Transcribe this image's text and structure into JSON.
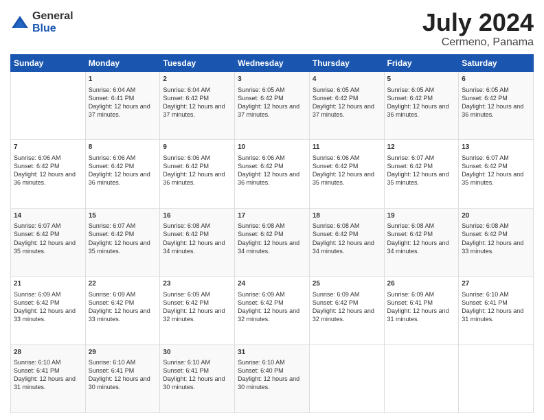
{
  "logo": {
    "general": "General",
    "blue": "Blue"
  },
  "header": {
    "month_year": "July 2024",
    "location": "Cermeno, Panama"
  },
  "weekdays": [
    "Sunday",
    "Monday",
    "Tuesday",
    "Wednesday",
    "Thursday",
    "Friday",
    "Saturday"
  ],
  "weeks": [
    [
      {
        "day": "",
        "sunrise": "",
        "sunset": "",
        "daylight": ""
      },
      {
        "day": "1",
        "sunrise": "Sunrise: 6:04 AM",
        "sunset": "Sunset: 6:41 PM",
        "daylight": "Daylight: 12 hours and 37 minutes."
      },
      {
        "day": "2",
        "sunrise": "Sunrise: 6:04 AM",
        "sunset": "Sunset: 6:42 PM",
        "daylight": "Daylight: 12 hours and 37 minutes."
      },
      {
        "day": "3",
        "sunrise": "Sunrise: 6:05 AM",
        "sunset": "Sunset: 6:42 PM",
        "daylight": "Daylight: 12 hours and 37 minutes."
      },
      {
        "day": "4",
        "sunrise": "Sunrise: 6:05 AM",
        "sunset": "Sunset: 6:42 PM",
        "daylight": "Daylight: 12 hours and 37 minutes."
      },
      {
        "day": "5",
        "sunrise": "Sunrise: 6:05 AM",
        "sunset": "Sunset: 6:42 PM",
        "daylight": "Daylight: 12 hours and 36 minutes."
      },
      {
        "day": "6",
        "sunrise": "Sunrise: 6:05 AM",
        "sunset": "Sunset: 6:42 PM",
        "daylight": "Daylight: 12 hours and 36 minutes."
      }
    ],
    [
      {
        "day": "7",
        "sunrise": "Sunrise: 6:06 AM",
        "sunset": "Sunset: 6:42 PM",
        "daylight": "Daylight: 12 hours and 36 minutes."
      },
      {
        "day": "8",
        "sunrise": "Sunrise: 6:06 AM",
        "sunset": "Sunset: 6:42 PM",
        "daylight": "Daylight: 12 hours and 36 minutes."
      },
      {
        "day": "9",
        "sunrise": "Sunrise: 6:06 AM",
        "sunset": "Sunset: 6:42 PM",
        "daylight": "Daylight: 12 hours and 36 minutes."
      },
      {
        "day": "10",
        "sunrise": "Sunrise: 6:06 AM",
        "sunset": "Sunset: 6:42 PM",
        "daylight": "Daylight: 12 hours and 36 minutes."
      },
      {
        "day": "11",
        "sunrise": "Sunrise: 6:06 AM",
        "sunset": "Sunset: 6:42 PM",
        "daylight": "Daylight: 12 hours and 35 minutes."
      },
      {
        "day": "12",
        "sunrise": "Sunrise: 6:07 AM",
        "sunset": "Sunset: 6:42 PM",
        "daylight": "Daylight: 12 hours and 35 minutes."
      },
      {
        "day": "13",
        "sunrise": "Sunrise: 6:07 AM",
        "sunset": "Sunset: 6:42 PM",
        "daylight": "Daylight: 12 hours and 35 minutes."
      }
    ],
    [
      {
        "day": "14",
        "sunrise": "Sunrise: 6:07 AM",
        "sunset": "Sunset: 6:42 PM",
        "daylight": "Daylight: 12 hours and 35 minutes."
      },
      {
        "day": "15",
        "sunrise": "Sunrise: 6:07 AM",
        "sunset": "Sunset: 6:42 PM",
        "daylight": "Daylight: 12 hours and 35 minutes."
      },
      {
        "day": "16",
        "sunrise": "Sunrise: 6:08 AM",
        "sunset": "Sunset: 6:42 PM",
        "daylight": "Daylight: 12 hours and 34 minutes."
      },
      {
        "day": "17",
        "sunrise": "Sunrise: 6:08 AM",
        "sunset": "Sunset: 6:42 PM",
        "daylight": "Daylight: 12 hours and 34 minutes."
      },
      {
        "day": "18",
        "sunrise": "Sunrise: 6:08 AM",
        "sunset": "Sunset: 6:42 PM",
        "daylight": "Daylight: 12 hours and 34 minutes."
      },
      {
        "day": "19",
        "sunrise": "Sunrise: 6:08 AM",
        "sunset": "Sunset: 6:42 PM",
        "daylight": "Daylight: 12 hours and 34 minutes."
      },
      {
        "day": "20",
        "sunrise": "Sunrise: 6:08 AM",
        "sunset": "Sunset: 6:42 PM",
        "daylight": "Daylight: 12 hours and 33 minutes."
      }
    ],
    [
      {
        "day": "21",
        "sunrise": "Sunrise: 6:09 AM",
        "sunset": "Sunset: 6:42 PM",
        "daylight": "Daylight: 12 hours and 33 minutes."
      },
      {
        "day": "22",
        "sunrise": "Sunrise: 6:09 AM",
        "sunset": "Sunset: 6:42 PM",
        "daylight": "Daylight: 12 hours and 33 minutes."
      },
      {
        "day": "23",
        "sunrise": "Sunrise: 6:09 AM",
        "sunset": "Sunset: 6:42 PM",
        "daylight": "Daylight: 12 hours and 32 minutes."
      },
      {
        "day": "24",
        "sunrise": "Sunrise: 6:09 AM",
        "sunset": "Sunset: 6:42 PM",
        "daylight": "Daylight: 12 hours and 32 minutes."
      },
      {
        "day": "25",
        "sunrise": "Sunrise: 6:09 AM",
        "sunset": "Sunset: 6:42 PM",
        "daylight": "Daylight: 12 hours and 32 minutes."
      },
      {
        "day": "26",
        "sunrise": "Sunrise: 6:09 AM",
        "sunset": "Sunset: 6:41 PM",
        "daylight": "Daylight: 12 hours and 31 minutes."
      },
      {
        "day": "27",
        "sunrise": "Sunrise: 6:10 AM",
        "sunset": "Sunset: 6:41 PM",
        "daylight": "Daylight: 12 hours and 31 minutes."
      }
    ],
    [
      {
        "day": "28",
        "sunrise": "Sunrise: 6:10 AM",
        "sunset": "Sunset: 6:41 PM",
        "daylight": "Daylight: 12 hours and 31 minutes."
      },
      {
        "day": "29",
        "sunrise": "Sunrise: 6:10 AM",
        "sunset": "Sunset: 6:41 PM",
        "daylight": "Daylight: 12 hours and 30 minutes."
      },
      {
        "day": "30",
        "sunrise": "Sunrise: 6:10 AM",
        "sunset": "Sunset: 6:41 PM",
        "daylight": "Daylight: 12 hours and 30 minutes."
      },
      {
        "day": "31",
        "sunrise": "Sunrise: 6:10 AM",
        "sunset": "Sunset: 6:40 PM",
        "daylight": "Daylight: 12 hours and 30 minutes."
      },
      {
        "day": "",
        "sunrise": "",
        "sunset": "",
        "daylight": ""
      },
      {
        "day": "",
        "sunrise": "",
        "sunset": "",
        "daylight": ""
      },
      {
        "day": "",
        "sunrise": "",
        "sunset": "",
        "daylight": ""
      }
    ]
  ]
}
